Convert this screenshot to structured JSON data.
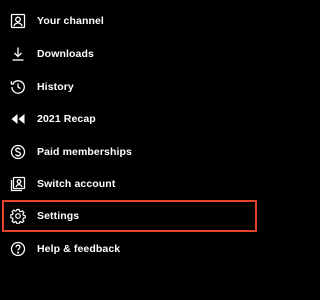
{
  "menu": {
    "items": [
      {
        "label": "Your channel",
        "icon": "account-box-icon"
      },
      {
        "label": "Downloads",
        "icon": "download-icon"
      },
      {
        "label": "History",
        "icon": "history-icon"
      },
      {
        "label": "2021 Recap",
        "icon": "rewind-icon"
      },
      {
        "label": "Paid memberships",
        "icon": "dollar-circle-icon"
      },
      {
        "label": "Switch account",
        "icon": "switch-account-icon"
      },
      {
        "label": "Settings",
        "icon": "gear-icon"
      },
      {
        "label": "Help & feedback",
        "icon": "help-circle-icon"
      }
    ],
    "highlighted_item": "Settings"
  },
  "colors": {
    "background": "#000000",
    "text": "#ffffff",
    "highlight": "#e8432c"
  }
}
